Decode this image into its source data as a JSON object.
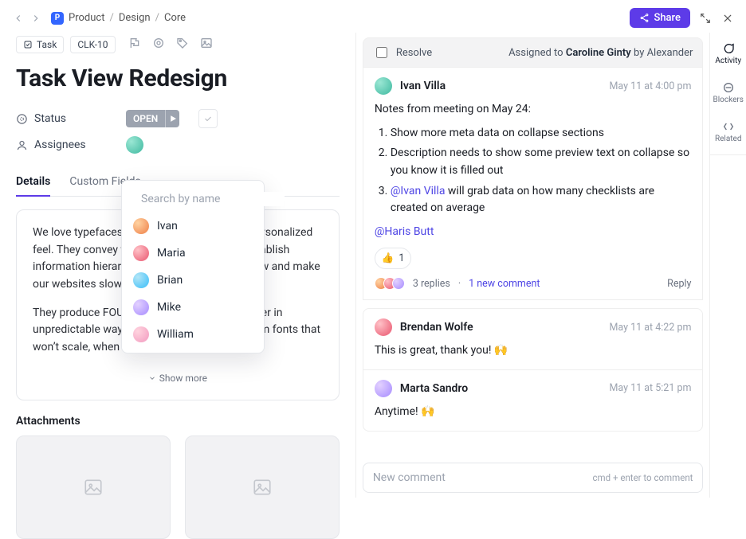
{
  "breadcrumb": {
    "badge": "P",
    "items": [
      "Product",
      "Design",
      "Core"
    ]
  },
  "topbar": {
    "share": "Share"
  },
  "task": {
    "type_label": "Task",
    "id": "CLK-10",
    "title": "Task View Redesign",
    "status_label": "Status",
    "status_value": "OPEN",
    "assignees_label": "Assignees"
  },
  "tabs": [
    "Details",
    "Custom Fields"
  ],
  "desc": {
    "p1": "We love typefaces. They give your websites personalized feel. They convey the information and they establish information hierarchy. But they’re also very slow and make our websites slow.",
    "p2": "They produce FOUT, FOIT and FOFT. They render in unpredictable ways. Why should we use custom fonts that won’t scale, when the",
    "showmore": "Show more"
  },
  "attachments_title": "Attachments",
  "popover": {
    "placeholder": "Search by name",
    "items": [
      "Ivan",
      "Maria",
      "Brian",
      "Mike",
      "William"
    ]
  },
  "thread": {
    "resolve": "Resolve",
    "assigned_prefix": "Assigned to ",
    "assigned_name": "Caroline Ginty",
    "assigned_by": " by Alexander"
  },
  "comments": [
    {
      "author": "Ivan Villa",
      "time": "May 11 at 4:00 pm",
      "lead": "Notes from meeting on May 24:",
      "points": [
        "Show more meta data on collapse sections",
        "Description needs to show some preview text on collapse so you know it is filled out"
      ],
      "point3_mention": "@Ivan Villa",
      "point3_rest": " will grab data on how many checklists are created on average",
      "trailing_mention": "@Haris Butt",
      "reaction_emoji": "👍",
      "reaction_count": "1",
      "replies": "3 replies",
      "new_comment": "1 new comment",
      "reply": "Reply"
    },
    {
      "author": "Brendan Wolfe",
      "time": "May 11 at 4:22 pm",
      "body": "This is great, thank you! 🙌"
    },
    {
      "author": "Marta Sandro",
      "time": "May 11 at 5:21 pm",
      "body": "Anytime! 🙌"
    }
  ],
  "composer": {
    "placeholder": "New comment",
    "hint": "cmd + enter to comment"
  },
  "rail": {
    "activity": "Activity",
    "blockers": "Blockers",
    "related": "Related"
  }
}
